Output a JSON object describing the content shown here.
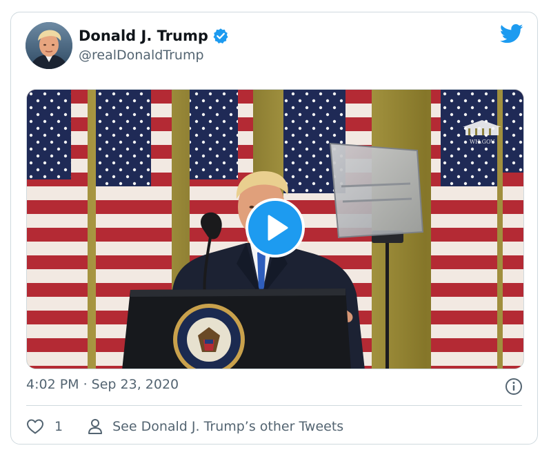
{
  "tweet": {
    "author": {
      "name": "Donald J. Trump",
      "handle": "@realDonaldTrump",
      "verified": true,
      "avatar_icon": "profile-photo"
    },
    "platform_icon": "twitter-bird-icon",
    "media": {
      "type": "video",
      "play_icon": "play-icon",
      "watermark": "WH.GOV",
      "seal_text": "SEAL OF THE PRESIDENT OF THE UNITED STATES"
    },
    "timestamp": "4:02 PM · Sep 23, 2020",
    "info_icon": "info-icon",
    "actions": {
      "like_count": "1",
      "other_tweets_label": "See Donald J. Trump’s other Tweets"
    }
  },
  "colors": {
    "accent": "#1d9bf0",
    "text_primary": "#0f1419",
    "text_secondary": "#536471",
    "border": "#cfd9de"
  }
}
